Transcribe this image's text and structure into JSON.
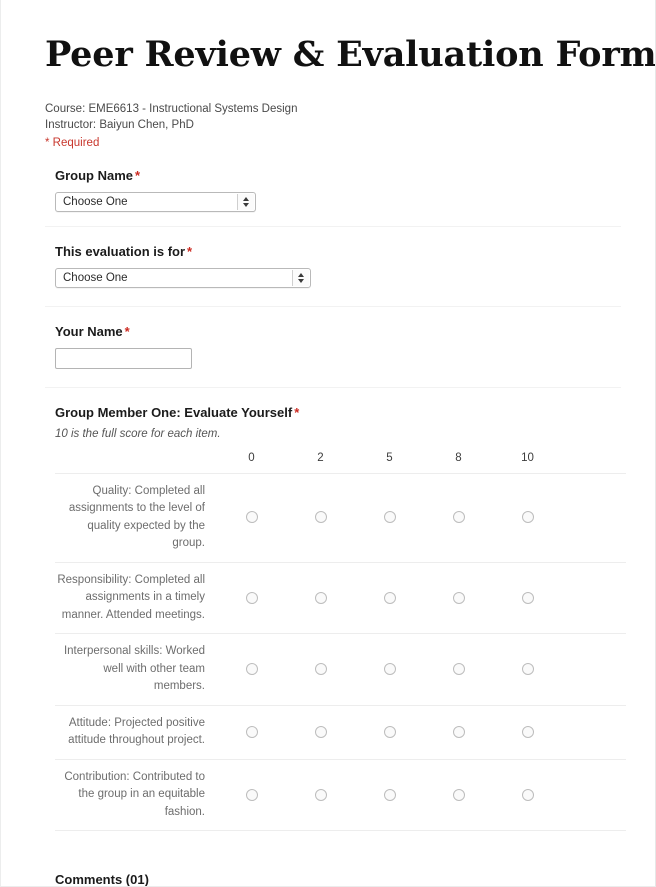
{
  "form": {
    "title": "Peer Review & Evaluation Form",
    "course_line": "Course: EME6613 - Instructional Systems Design",
    "instructor_line": "Instructor: Baiyun Chen, PhD",
    "required_note": "* Required",
    "required_marker": "*"
  },
  "questions": {
    "group_name": {
      "label": "Group Name",
      "selected": "Choose One"
    },
    "evaluation_for": {
      "label": "This evaluation is for",
      "selected": "Choose One"
    },
    "your_name": {
      "label": "Your Name",
      "value": ""
    }
  },
  "rating_section": {
    "label": "Group Member One: Evaluate Yourself",
    "hint": "10 is the full score for each item.",
    "scale": [
      "0",
      "2",
      "5",
      "8",
      "10"
    ],
    "rows": [
      "Quality: Completed all assignments to the level of quality expected by the group.",
      "Responsibility: Completed all assignments in a timely manner. Attended meetings.",
      "Interpersonal skills: Worked well with other team members.",
      "Attitude: Projected positive attitude throughout project.",
      "Contribution: Contributed to the group in an equitable fashion."
    ]
  },
  "comments": {
    "title": "Comments (01)"
  },
  "colors": {
    "required_red": "#cc2a21",
    "note_red": "#c8372d",
    "text_dark": "#1b1b1b",
    "text_muted": "#6d6d6d",
    "rule": "#ededed"
  }
}
